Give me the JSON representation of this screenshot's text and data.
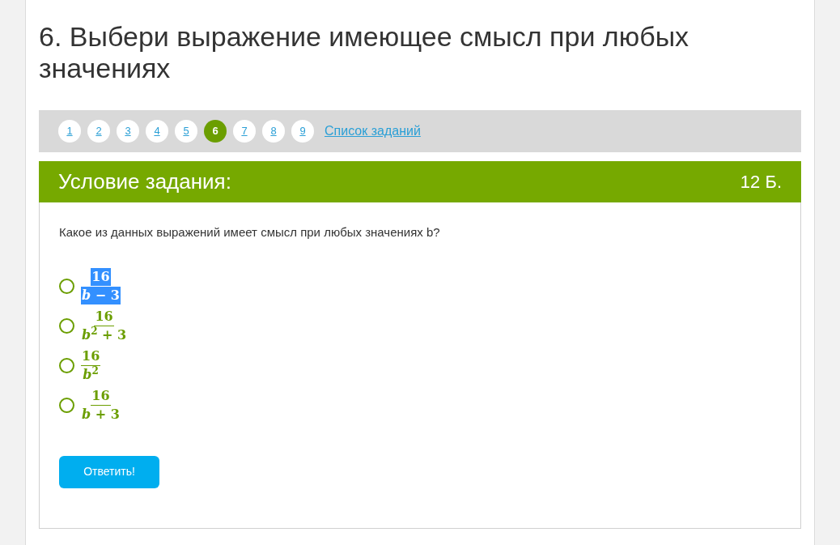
{
  "title": "6. Выбери выражение имеющее смысл при любых значениях",
  "nav": {
    "items": [
      {
        "label": "1",
        "selected": false
      },
      {
        "label": "2",
        "selected": false
      },
      {
        "label": "3",
        "selected": false
      },
      {
        "label": "4",
        "selected": false
      },
      {
        "label": "5",
        "selected": false
      },
      {
        "label": "6",
        "selected": true
      },
      {
        "label": "7",
        "selected": false
      },
      {
        "label": "8",
        "selected": false
      },
      {
        "label": "9",
        "selected": false
      }
    ],
    "list_link": "Список заданий"
  },
  "task": {
    "heading": "Условие задания:",
    "points": "12 Б.",
    "question": "Какое из данных выражений имеет смысл при любых значениях b?",
    "options": [
      {
        "numerator": "16",
        "denominator": "*b* − 3",
        "checked": false,
        "highlighted": true
      },
      {
        "numerator": "16",
        "denominator": "*b*$^{2}$ + 3",
        "checked": false,
        "highlighted": false
      },
      {
        "numerator": "16",
        "denominator": "*b*$^{2}$",
        "checked": false,
        "highlighted": false
      },
      {
        "numerator": "16",
        "denominator": "*b* + 3",
        "checked": false,
        "highlighted": false
      }
    ],
    "submit": "Ответить!"
  }
}
